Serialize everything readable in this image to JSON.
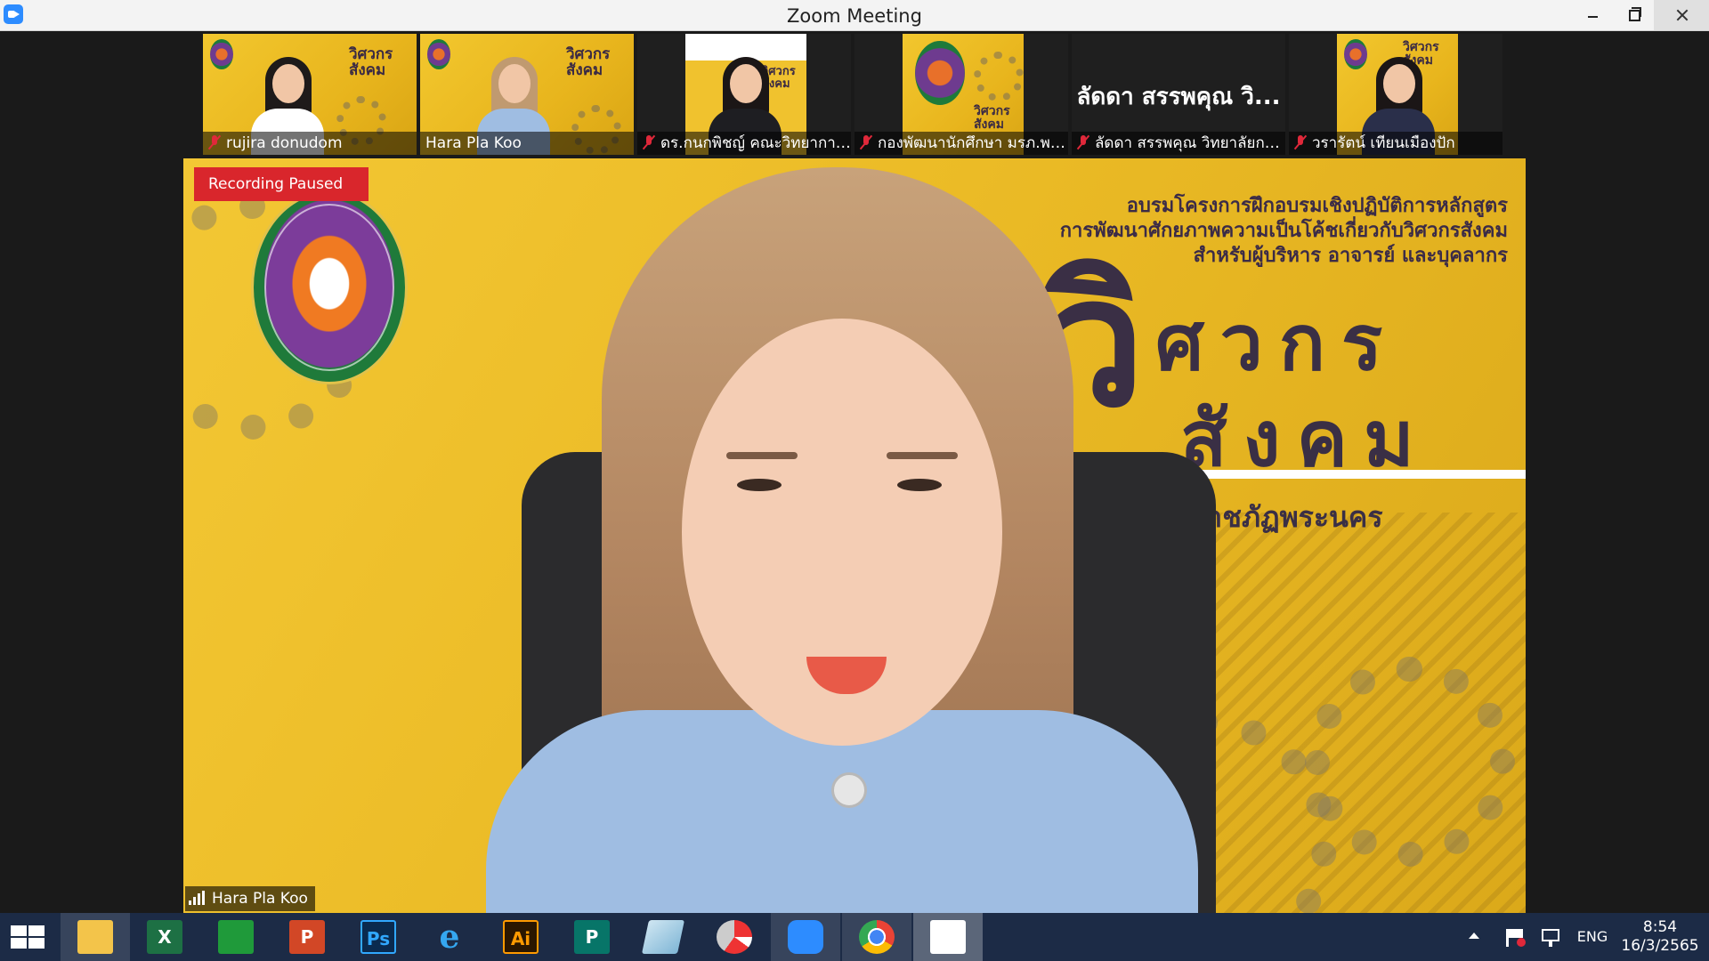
{
  "window": {
    "title": "Zoom Meeting"
  },
  "participants": [
    {
      "name": "rujira donudom",
      "muted": true
    },
    {
      "name": "Hara Pla Koo",
      "muted": false,
      "active": true
    },
    {
      "name": "ดร.กนกพิชญ์ คณะวิทยาการ...",
      "muted": true
    },
    {
      "name": "กองพัฒนานักศึกษา มรภ.พร...",
      "muted": true
    },
    {
      "name": "ลัดดา สรรพคุณ วิทยาลัยกา...",
      "muted": true,
      "display_name": "ลัดดา สรรพคุณ วิ..."
    },
    {
      "name": "วรารัตน์ เทียนเมืองปัก",
      "muted": true
    }
  ],
  "thumb_brand": "วิศวกร สังคม",
  "main_video": {
    "recording_status": "Recording Paused",
    "speaker_name": "Hara Pla Koo",
    "backdrop": {
      "headline_lines": [
        "อบรมโครงการฝึกอบรมเชิงปฏิบัติการหลักสูตร",
        "การพัฒนาศักยภาพความเป็นโค้ชเกี่ยวกับวิศวกรสังคม",
        "สำหรับผู้บริหาร อาจารย์ และบุคลากร"
      ],
      "big_v": "วิ",
      "big_line1": "ศวกร",
      "big_line2": "สังคม",
      "university": "าวิทยาลัยราชภัฏพระนคร"
    }
  },
  "taskbar": {
    "apps": [
      {
        "name": "file-explorer",
        "glyph": ""
      },
      {
        "name": "excel",
        "glyph": "X"
      },
      {
        "name": "store",
        "glyph": ""
      },
      {
        "name": "powerpoint",
        "glyph": "P"
      },
      {
        "name": "photoshop",
        "glyph": "Ps"
      },
      {
        "name": "internet-explorer",
        "glyph": "e"
      },
      {
        "name": "illustrator",
        "glyph": "Ai"
      },
      {
        "name": "publisher",
        "glyph": "P"
      },
      {
        "name": "notepad",
        "glyph": ""
      },
      {
        "name": "photoscape",
        "glyph": ""
      },
      {
        "name": "zoom",
        "glyph": ""
      },
      {
        "name": "chrome",
        "glyph": ""
      },
      {
        "name": "photos",
        "glyph": ""
      }
    ],
    "language": "ENG",
    "time": "8:54",
    "date": "16/3/2565"
  },
  "colors": {
    "recording": "#d9262c",
    "active_border": "#f0c400",
    "taskbar": "#1c2b46",
    "backdrop_yellow": "#ebbb26"
  }
}
